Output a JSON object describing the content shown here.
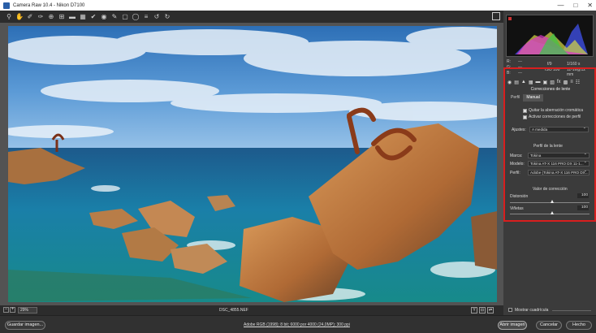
{
  "window": {
    "title": "Camera Raw 10.4  -  Nikon D7100",
    "min": "—",
    "max": "□",
    "close": "✕"
  },
  "toolbar": {
    "tools": [
      "zoom-icon",
      "hand-icon",
      "white-balance-icon",
      "color-sampler-icon",
      "target-adjust-icon",
      "crop-icon",
      "straighten-icon",
      "transform-icon",
      "spot-removal-icon",
      "red-eye-icon",
      "adjustment-brush-icon",
      "graduated-filter-icon",
      "radial-filter-icon",
      "preferences-icon",
      "rotate-left-icon",
      "rotate-right-icon"
    ]
  },
  "readout": {
    "r": "R:",
    "g": "G:",
    "b": "B:",
    "dash": "---",
    "aperture": "f/9",
    "shutter": "1/160 s",
    "iso": "ISO 100",
    "focal": "11-16@12 mm"
  },
  "panel": {
    "title": "Correcciones de lente",
    "tabs": [
      "Perfil",
      "Manual"
    ],
    "chk1": "Quitar la aberración cromática",
    "chk2": "Activar correcciones de perfil",
    "ajustes_label": "Ajustes:",
    "ajustes_value": "A medida",
    "lens_profile_title": "Perfil de la lente",
    "marca_label": "Marca:",
    "marca_value": "Tokina",
    "modelo_label": "Modelo:",
    "modelo_value": "Tokina AT-X 116 PRO DX 11-1...",
    "perfil_label": "Perfil:",
    "perfil_value": "Adobe (Tokina AT-X 116 PRO DX...",
    "correction_title": "Valor de corrección",
    "distorsion_label": "Distorsión",
    "distorsion_value": "100",
    "vinetas_label": "Viñetas",
    "vinetas_value": "100"
  },
  "status": {
    "zoom": "29%",
    "minus": "−",
    "plus": "+",
    "filename": "DSC_4855.NEF",
    "y": "Y",
    "views": [
      "⊟",
      "⇄"
    ]
  },
  "rp_bottom": {
    "grid_label": "Mostrar cuadrícula"
  },
  "bottom": {
    "save": "Guardar imagen...",
    "workflow": "Adobe RGB (1998); 8 bit; 6000 por 4000 (24,0MP); 300 ppi",
    "open": "Abrir imagen",
    "cancel": "Cancelar",
    "done": "Hecho"
  },
  "colors": {
    "highlight_border": "#d81e1e",
    "panel_bg": "#3b3b3b"
  }
}
